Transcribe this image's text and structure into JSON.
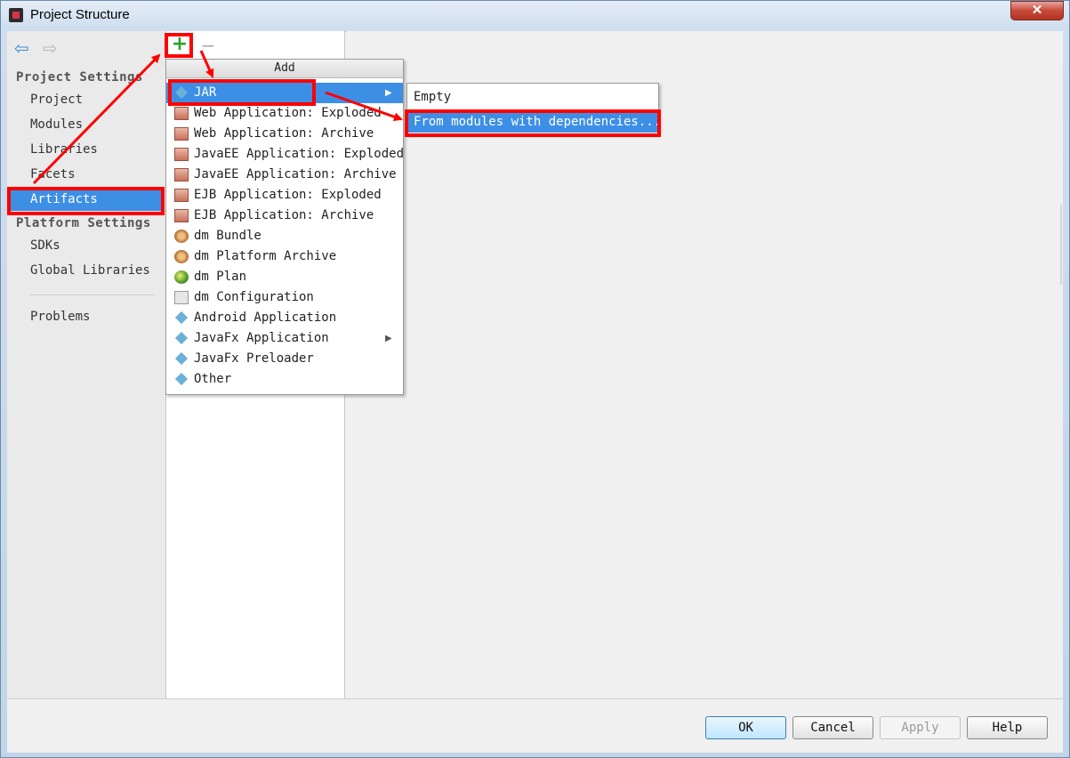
{
  "window": {
    "title": "Project Structure",
    "close_label": "✕"
  },
  "nav": {
    "back": "⇦",
    "forward": "⇨"
  },
  "sidebar": {
    "project_settings_header": "Project Settings",
    "project_items": [
      "Project",
      "Modules",
      "Libraries",
      "Facets",
      "Artifacts"
    ],
    "selected_item": "Artifacts",
    "platform_settings_header": "Platform Settings",
    "platform_items": [
      "SDKs",
      "Global Libraries"
    ],
    "problems": "Problems"
  },
  "toolbar": {
    "add_symbol": "+",
    "remove_symbol": "−"
  },
  "add_menu": {
    "header": "Add",
    "items": [
      {
        "label": "JAR",
        "icon": "jar-icon",
        "submenu": true,
        "selected": true
      },
      {
        "label": "Web Application: Exploded",
        "icon": "web-exploded-icon"
      },
      {
        "label": "Web Application: Archive",
        "icon": "web-archive-icon"
      },
      {
        "label": "JavaEE Application: Exploded",
        "icon": "javaee-exploded-icon"
      },
      {
        "label": "JavaEE Application: Archive",
        "icon": "javaee-archive-icon"
      },
      {
        "label": "EJB Application: Exploded",
        "icon": "ejb-exploded-icon"
      },
      {
        "label": "EJB Application: Archive",
        "icon": "ejb-archive-icon"
      },
      {
        "label": "dm Bundle",
        "icon": "dm-bundle-icon"
      },
      {
        "label": "dm Platform Archive",
        "icon": "dm-platform-archive-icon"
      },
      {
        "label": "dm Plan",
        "icon": "dm-plan-icon"
      },
      {
        "label": "dm Configuration",
        "icon": "dm-configuration-icon"
      },
      {
        "label": "Android Application",
        "icon": "android-icon"
      },
      {
        "label": "JavaFx Application",
        "icon": "javafx-icon",
        "submenu": true
      },
      {
        "label": "JavaFx Preloader",
        "icon": "javafx-preloader-icon"
      },
      {
        "label": "Other",
        "icon": "other-icon"
      }
    ],
    "submenu_arrow": "▶"
  },
  "jar_submenu": {
    "items": [
      {
        "label": "Empty"
      },
      {
        "label": "From modules with dependencies...",
        "selected": true
      }
    ]
  },
  "buttons": {
    "ok": "OK",
    "cancel": "Cancel",
    "apply": "Apply",
    "help": "Help"
  },
  "colors": {
    "selection": "#3d8fe6",
    "highlight": "#ff0000",
    "add_green": "#2aa02a"
  }
}
